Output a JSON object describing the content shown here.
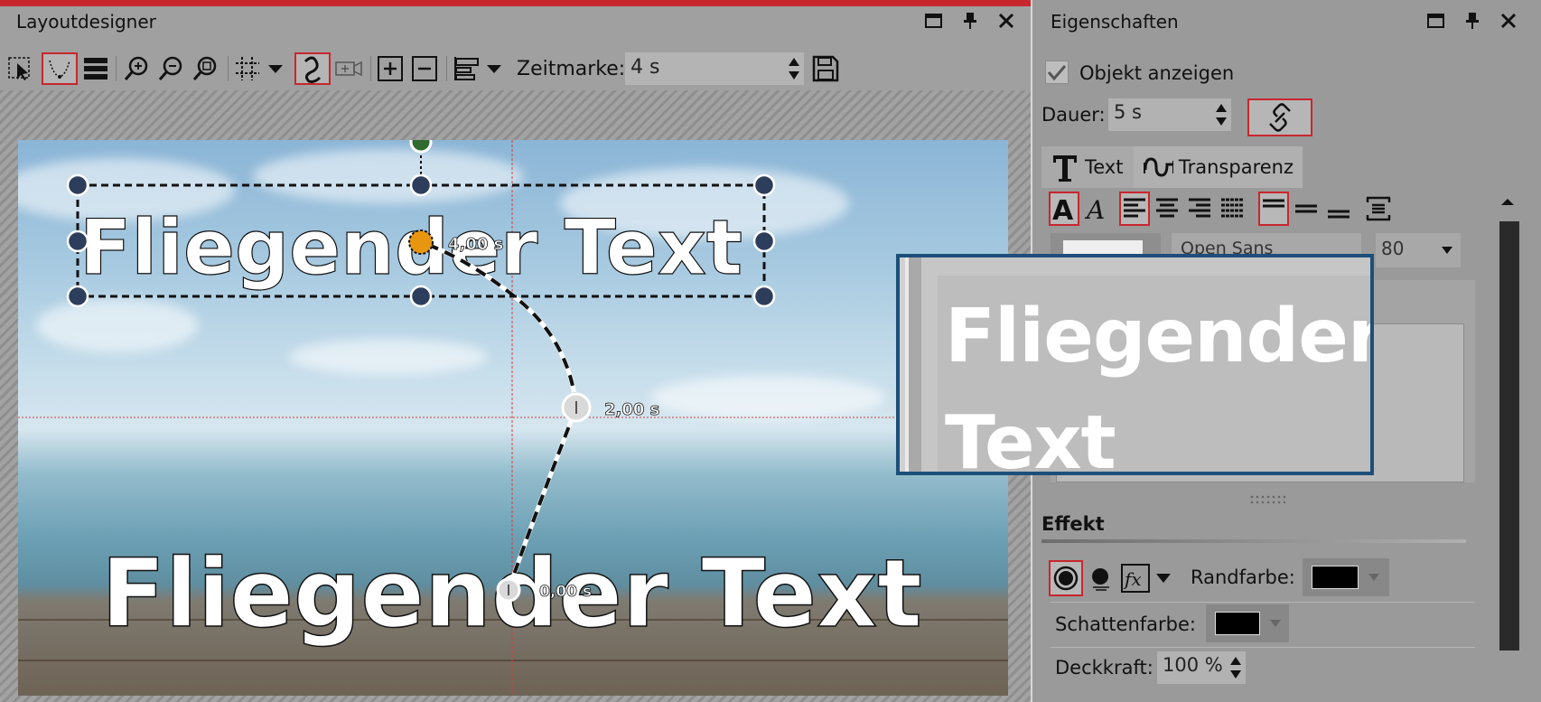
{
  "left_panel": {
    "title": "Layoutdesigner"
  },
  "toolbar": {
    "zeitmarke_label": "Zeitmarke:",
    "zeitmarke_value": "4 s"
  },
  "stage": {
    "text_object": "Fliegender Text",
    "keyframes": {
      "start_label": "0,00 s",
      "mid_label": "2,00 s",
      "end_label": "4,00 s"
    }
  },
  "right_panel": {
    "title": "Eigenschaften",
    "objekt_anzeigen_label": "Objekt anzeigen",
    "objekt_anzeigen_checked": true,
    "dauer_label": "Dauer:",
    "dauer_value": "5 s",
    "tabs": [
      {
        "label": "Text",
        "active": true
      },
      {
        "label": "Transparenz",
        "active": false
      }
    ],
    "font_name": "Open Sans",
    "font_size": "80",
    "effekt_heading": "Effekt",
    "randfarbe_label": "Randfarbe:",
    "randfarbe_color": "#000000",
    "schattenfarbe_label": "Schattenfarbe:",
    "schattenfarbe_color": "#000000",
    "deckkraft_label": "Deckkraft:",
    "deckkraft_value": "100 %"
  },
  "tooltip": {
    "line1": "Fliegender",
    "line2": "Text"
  },
  "colors": {
    "accent_red": "#c8262d",
    "tooltip_border": "#1d4f7a",
    "keyframe_orange": "#e8960f",
    "handle_navy": "#2d3d5c",
    "rotate_handle_green": "#2f6b2f"
  }
}
